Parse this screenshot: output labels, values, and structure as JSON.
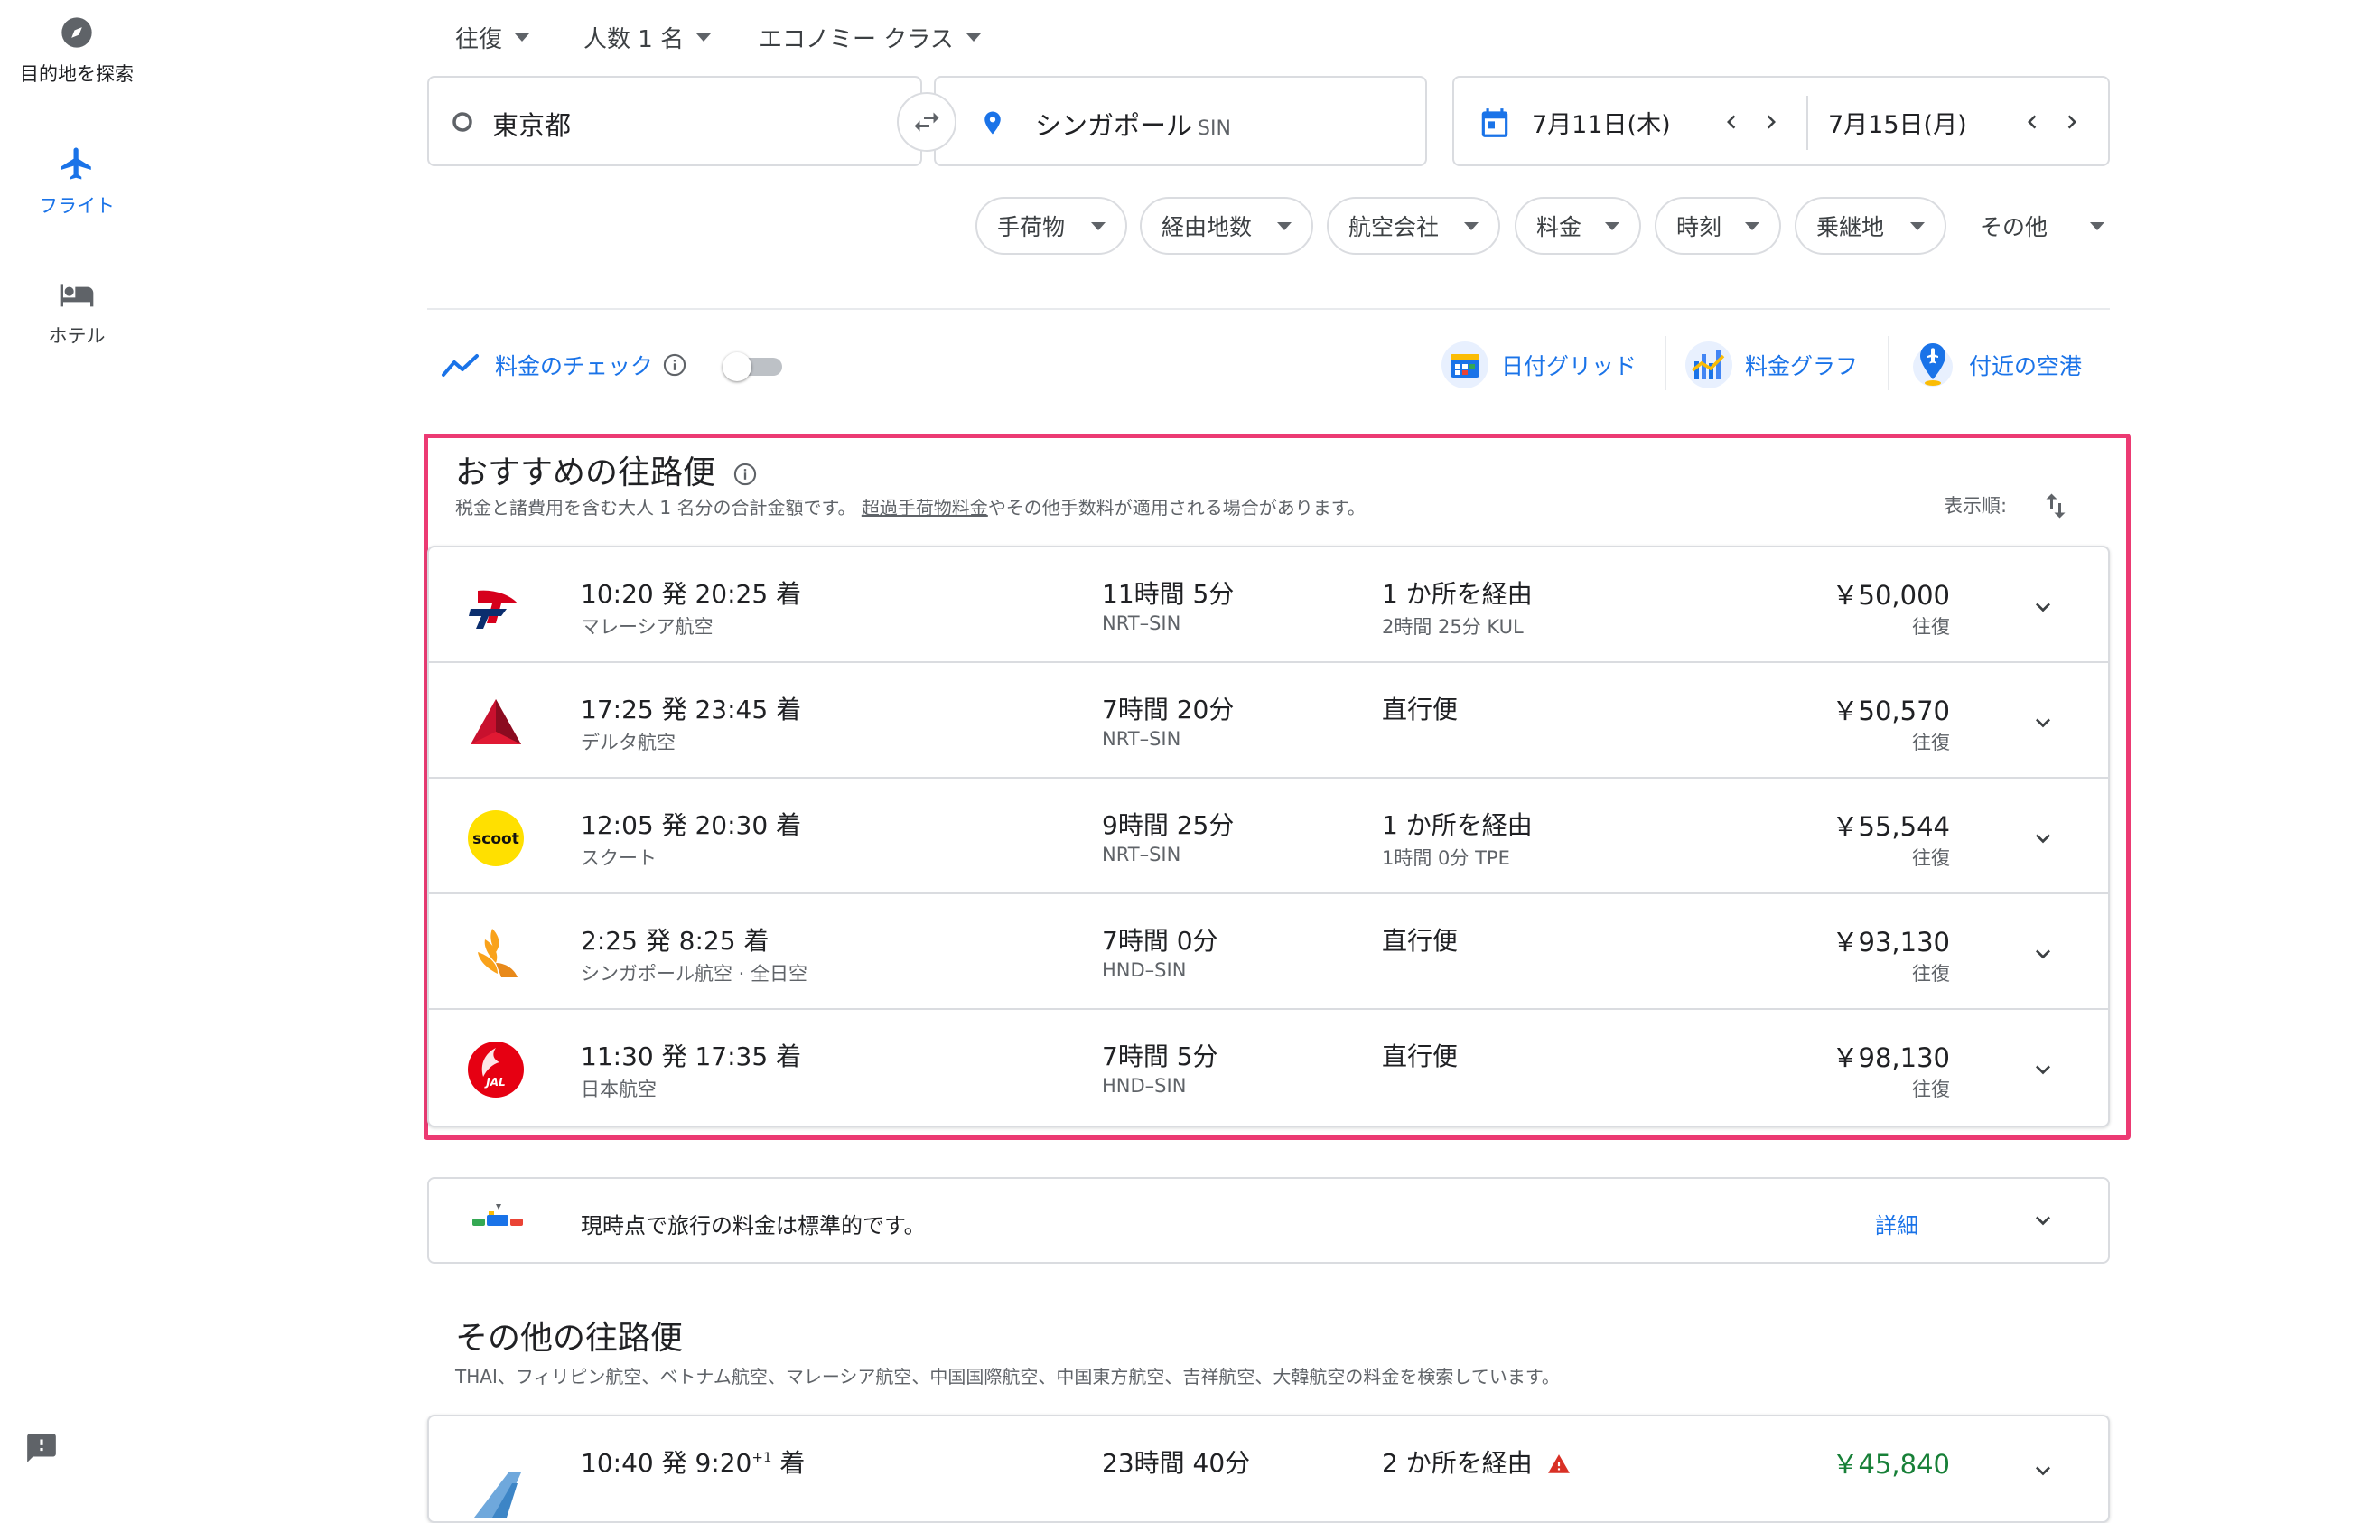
{
  "nav": {
    "explore_label": "目的地を探索",
    "flights_label": "フライト",
    "hotels_label": "ホテル"
  },
  "search": {
    "trip_type": "往復",
    "passengers": "人数 1 名",
    "cabin_class": "エコノミー クラス",
    "origin": "東京都",
    "destination": "シンガポール",
    "destination_code": "SIN",
    "depart_date": "7月11日(木)",
    "return_date": "7月15日(月)"
  },
  "filters": [
    "手荷物",
    "経由地数",
    "航空会社",
    "料金",
    "時刻",
    "乗継地",
    "その他"
  ],
  "tools": {
    "price_tracking_label": "料金のチェック",
    "price_tracking_on": false,
    "date_grid_label": "日付グリッド",
    "price_graph_label": "料金グラフ",
    "nearby_airports_label": "付近の空港"
  },
  "best_flights": {
    "title": "おすすめの往路便",
    "subtitle_prefix": "税金と諸費用を含む大人 1 名分の合計金額です。",
    "subtitle_link": "超過手荷物料金",
    "subtitle_suffix": "やその他手数料が適用される場合があります。",
    "sort_label": "表示順:",
    "flights": [
      {
        "airline_logo": "malaysia-airlines-logo",
        "times": "10:20 発 20:25 着",
        "airline": "マレーシア航空",
        "duration": "11時間 5分",
        "route": "NRT–SIN",
        "stops": "1 か所を経由",
        "stop_detail": "2時間 25分 KUL",
        "price": "￥50,000",
        "price_type": "往復"
      },
      {
        "airline_logo": "delta-logo",
        "times": "17:25 発 23:45 着",
        "airline": "デルタ航空",
        "duration": "7時間 20分",
        "route": "NRT–SIN",
        "stops": "直行便",
        "stop_detail": "",
        "price": "￥50,570",
        "price_type": "往復"
      },
      {
        "airline_logo": "scoot-logo",
        "times": "12:05 発 20:30 着",
        "airline": "スクート",
        "duration": "9時間 25分",
        "route": "NRT–SIN",
        "stops": "1 か所を経由",
        "stop_detail": "1時間 0分 TPE",
        "price": "￥55,544",
        "price_type": "往復"
      },
      {
        "airline_logo": "singapore-airlines-logo",
        "times": "2:25 発 8:25 着",
        "airline": "シンガポール航空 · 全日空",
        "duration": "7時間 0分",
        "route": "HND–SIN",
        "stops": "直行便",
        "stop_detail": "",
        "price": "￥93,130",
        "price_type": "往復"
      },
      {
        "airline_logo": "jal-logo",
        "times": "11:30 発 17:35 着",
        "airline": "日本航空",
        "duration": "7時間 5分",
        "route": "HND–SIN",
        "stops": "直行便",
        "stop_detail": "",
        "price": "￥98,130",
        "price_type": "往復"
      }
    ]
  },
  "insight": {
    "text": "現時点で旅行の料金は標準的です。",
    "link": "詳細"
  },
  "other_flights": {
    "title": "その他の往路便",
    "subtitle": "THAI、フィリピン航空、ベトナム航空、マレーシア航空、中国国際航空、中国東方航空、吉祥航空、大韓航空の料金を検索しています。",
    "first": {
      "dep_time": "10:40 発 9:20",
      "day_offset": "+1",
      "arr_suffix": "着",
      "duration": "23時間 40分",
      "stops": "2 か所を経由",
      "price": "￥45,840"
    }
  },
  "colors": {
    "accent": "#1a73e8",
    "highlight_border": "#ec3a73",
    "price_green": "#188038"
  }
}
